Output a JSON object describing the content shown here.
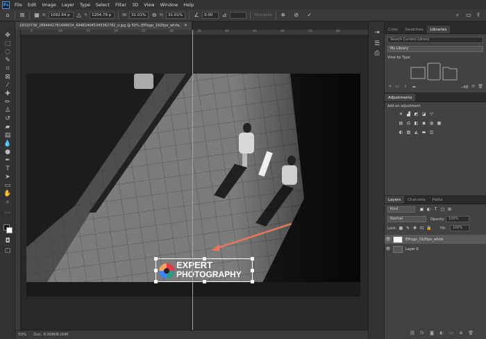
{
  "app": {
    "logo": "Ps"
  },
  "menu": [
    "File",
    "Edit",
    "Image",
    "Layer",
    "Type",
    "Select",
    "Filter",
    "3D",
    "View",
    "Window",
    "Help"
  ],
  "options": {
    "x_label": "X:",
    "x_value": "1092.64 p",
    "y_label": "Y:",
    "y_value": "1204.79 p",
    "w_label": "W:",
    "w_value": "31.01%",
    "h_label": "H:",
    "h_value": "31.01%",
    "angle_value": "0.00",
    "antialias_label": "Anti-alias"
  },
  "document": {
    "tab_title": "18320736_2894442781499024_694824045345362782_o.jpg @ 50% (EPlogo_1920px_white, RGB/8) *",
    "close": "×"
  },
  "ruler_numbers": [
    "5",
    "10",
    "15",
    "20",
    "25",
    "30",
    "35",
    "40",
    "45",
    "50",
    "55",
    "60"
  ],
  "logo_overlay": {
    "line1": "EXPERT",
    "line2": "PHOTOGRAPHY"
  },
  "status": {
    "zoom": "50%",
    "doc": "Doc: 8.00M/8.00M"
  },
  "panels": {
    "tabs_top": [
      "Color",
      "Swatches",
      "Libraries"
    ],
    "library_search_placeholder": "Search Current Library",
    "library_name": "My Library",
    "view_by": "View by Type",
    "kb_label": "--KB",
    "adjustments_tab": "Adjustments",
    "add_adjustment": "Add an adjustment",
    "layer_tabs": [
      "Layers",
      "Channels",
      "Paths"
    ],
    "kind_label": "Kind",
    "blend_mode": "Normal",
    "opacity_label": "Opacity:",
    "opacity_value": "100%",
    "lock_label": "Lock:",
    "fill_label": "Fill:",
    "fill_value": "100%",
    "layers": [
      {
        "name": "EPlogo_1920px_white"
      },
      {
        "name": "Layer 0"
      }
    ]
  },
  "colors": {
    "guide": "#3ad2d2",
    "arrow": "#e8765a",
    "accent": "#31a8ff"
  }
}
